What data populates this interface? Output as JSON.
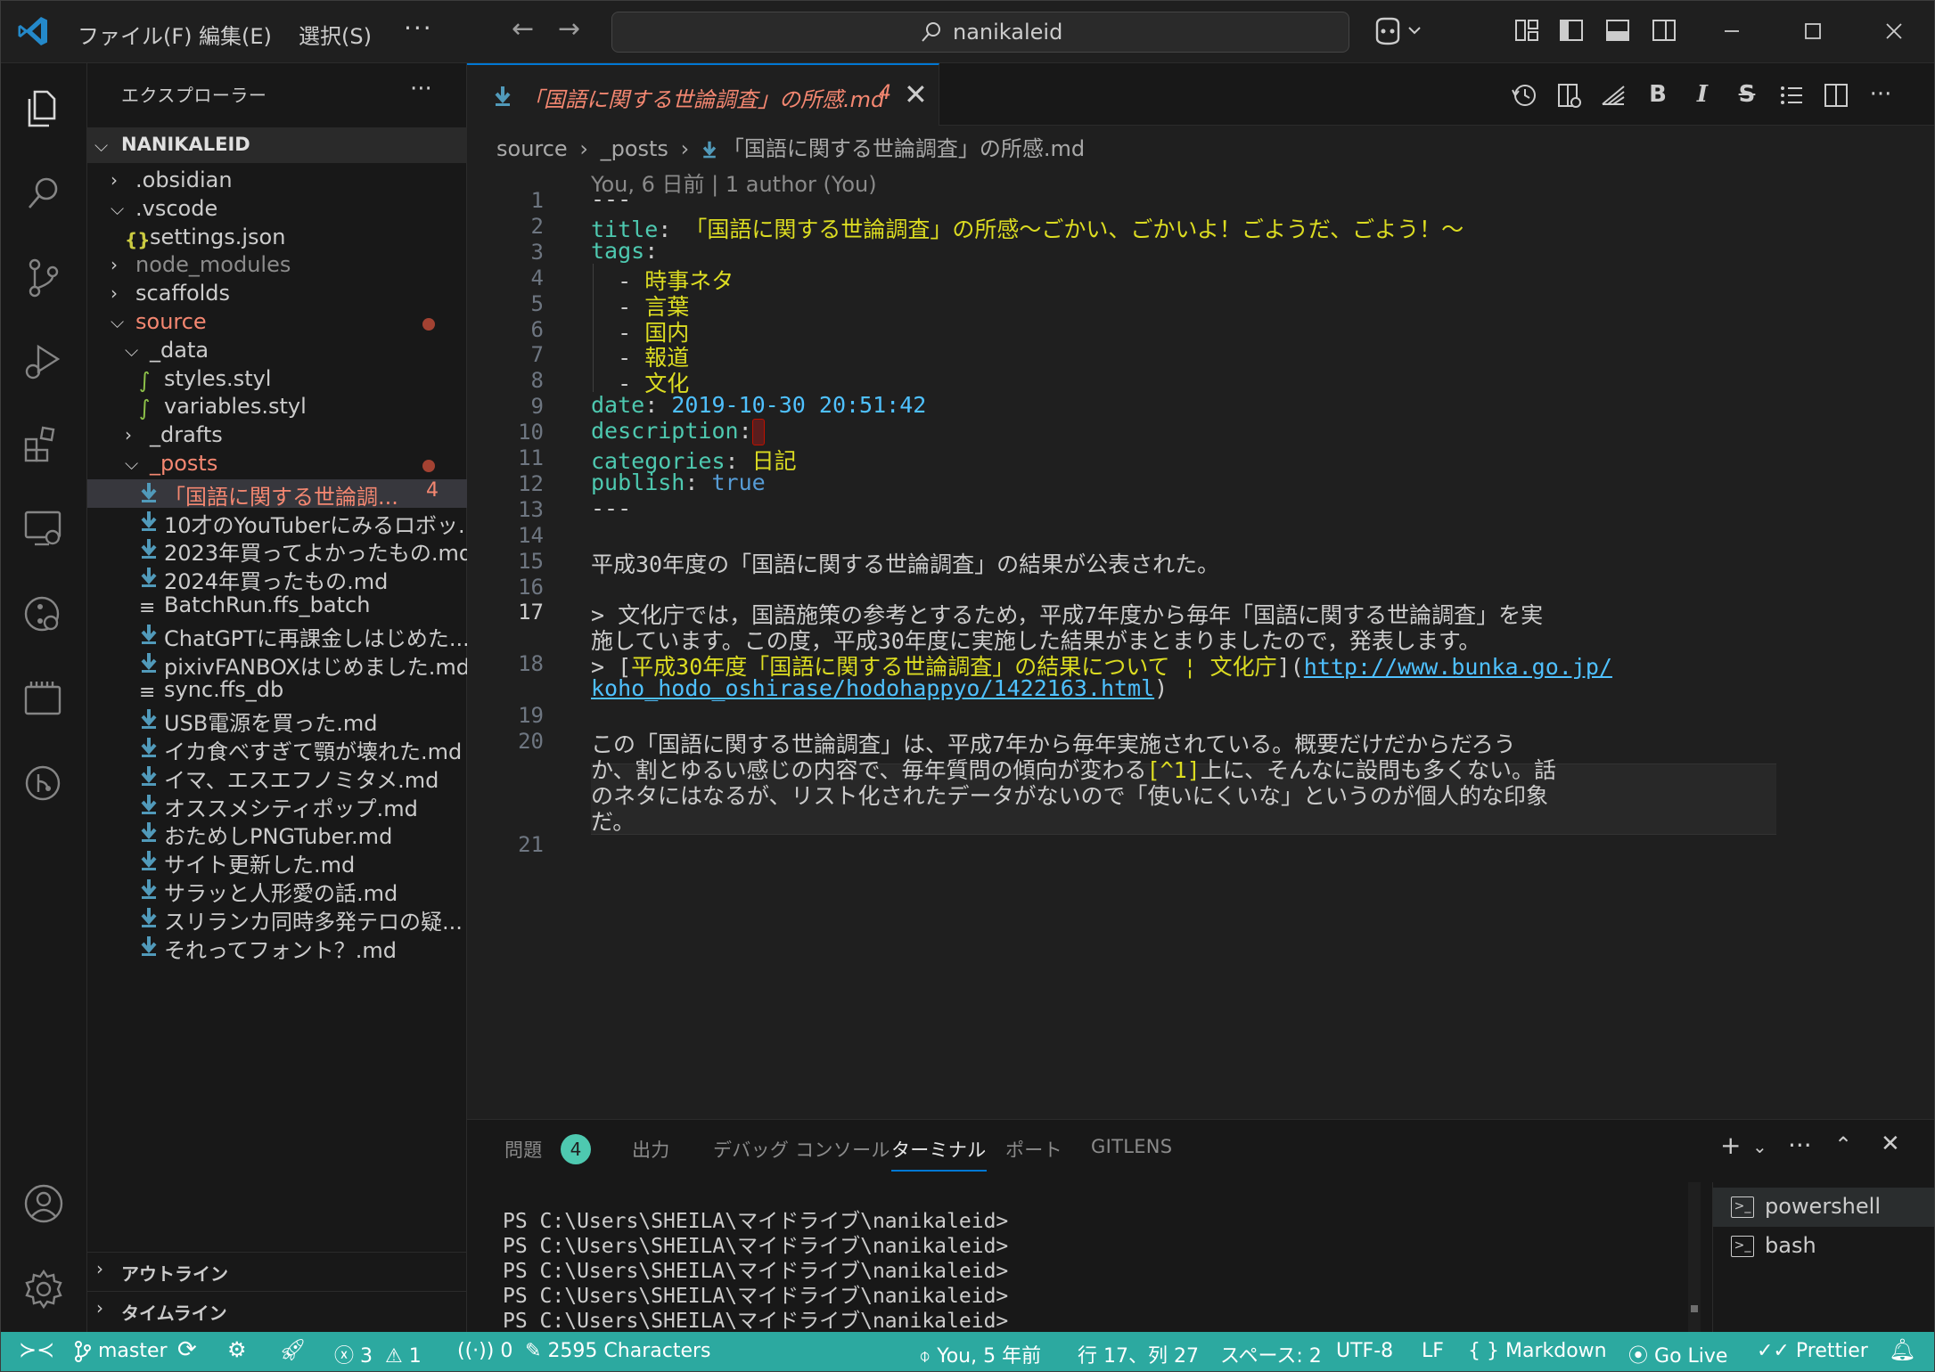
{
  "titlebar": {
    "menus": [
      "ファイル(F)",
      "編集(E)",
      "選択(S)"
    ],
    "more": "···",
    "search_text": "nanikaleid"
  },
  "sidebar": {
    "title": "エクスプローラー",
    "more": "···",
    "root": "NANIKALEID",
    "tree": [
      {
        "label": ".obsidian",
        "type": "folder",
        "open": false,
        "depth": 1
      },
      {
        "label": ".vscode",
        "type": "folder",
        "open": true,
        "depth": 1
      },
      {
        "label": "settings.json",
        "type": "json",
        "depth": 2
      },
      {
        "label": "node_modules",
        "type": "folder",
        "open": false,
        "depth": 1,
        "dim": true
      },
      {
        "label": "scaffolds",
        "type": "folder",
        "open": false,
        "depth": 1
      },
      {
        "label": "source",
        "type": "folder",
        "open": true,
        "depth": 1,
        "modified": true
      },
      {
        "label": "_data",
        "type": "folder",
        "open": true,
        "depth": 2
      },
      {
        "label": "styles.styl",
        "type": "styl",
        "depth": 3
      },
      {
        "label": "variables.styl",
        "type": "styl",
        "depth": 3
      },
      {
        "label": "_drafts",
        "type": "folder",
        "open": false,
        "depth": 2
      },
      {
        "label": "_posts",
        "type": "folder",
        "open": true,
        "depth": 2,
        "modified": true
      },
      {
        "label": "「国語に関する世論調...",
        "type": "md",
        "depth": 3,
        "modified": true,
        "selected": true,
        "badge": "4"
      },
      {
        "label": "10才のYouTuberにみるロボッ...",
        "type": "md",
        "depth": 3
      },
      {
        "label": "2023年買ってよかったもの.md",
        "type": "md",
        "depth": 3
      },
      {
        "label": "2024年買ったもの.md",
        "type": "md",
        "depth": 3
      },
      {
        "label": "BatchRun.ffs_batch",
        "type": "txt",
        "depth": 3
      },
      {
        "label": "ChatGPTに再課金しはじめた....",
        "type": "md",
        "depth": 3
      },
      {
        "label": "pixivFANBOXはじめました.md",
        "type": "md",
        "depth": 3
      },
      {
        "label": "sync.ffs_db",
        "type": "txt",
        "depth": 3
      },
      {
        "label": "USB電源を買った.md",
        "type": "md",
        "depth": 3
      },
      {
        "label": "イカ食べすぎて顎が壊れた.md",
        "type": "md",
        "depth": 3
      },
      {
        "label": "イマ、エスエフノミタメ.md",
        "type": "md",
        "depth": 3
      },
      {
        "label": "オススメシティポップ.md",
        "type": "md",
        "depth": 3
      },
      {
        "label": "おためしPNGTuber.md",
        "type": "md",
        "depth": 3
      },
      {
        "label": "サイト更新した.md",
        "type": "md",
        "depth": 3
      },
      {
        "label": "サラッと人形愛の話.md",
        "type": "md",
        "depth": 3
      },
      {
        "label": "スリランカ同時多発テロの疑...",
        "type": "md",
        "depth": 3
      },
      {
        "label": "それってフォント？.md",
        "type": "md",
        "depth": 3
      }
    ],
    "sections": [
      "アウトライン",
      "タイムライン"
    ]
  },
  "tab": {
    "label": "「国語に関する世論調査」の所感.md",
    "count": "4",
    "close": "✕"
  },
  "editor_tools": [
    "history",
    "open-changes",
    "toggle-inline",
    "B",
    "I",
    "S",
    "list",
    "split",
    "···"
  ],
  "breadcrumb": [
    "source",
    "_posts",
    "「国語に関する世論調査」の所感.md"
  ],
  "blame": "You, 6 日前 | 1 author (You)",
  "lines": {
    "l1": "---",
    "l2_key": "title",
    "l2_val": "「国語に関する世論調査」の所感～ごかい、ごかいよ！ごようだ、ごよう！～",
    "l3_key": "tags",
    "tags": [
      "時事ネタ",
      "言葉",
      "国内",
      "報道",
      "文化"
    ],
    "l9_key": "date",
    "l9_val": "2019-10-30 20:51:42",
    "l10_key": "description",
    "l11_key": "categories",
    "l11_val": "日記",
    "l12_key": "publish",
    "l12_val": "true",
    "l13": "---",
    "l15": "平成30年度の「国語に関する世論調査」の結果が公表された。",
    "l17a": "> 文化庁では，国語施策の参考とするため，平成7年度から毎年「国語に関する世論調査」を実",
    "l17b": "施しています。この度，平成30年度に実施した結果がまとまりましたので，発表します。",
    "l18_pre": "> [",
    "l18_link_text": "平成30年度「国語に関する世論調査」の結果について ¦ 文化庁",
    "l18_mid": "](",
    "l18_url1": "http://www.bunka.go.jp/",
    "l18_url2": "koho_hodo_oshirase/hodohappyo/1422163.html",
    "l18_end": ")",
    "l20a": "この「国語に関する世論調査」は、平成7年から毎年実施されている。概要だけだからだろう",
    "l20b": "か、割とゆるい感じの内容で、毎年質問の傾向が変わる[^1]上に、そんなに設問も多くない。話",
    "l20c": "のネタにはなるが、リスト化されたデータがないので「使いにくいな」というのが個人的な印象",
    "l20d": "だ。"
  },
  "line_numbers": [
    "1",
    "2",
    "3",
    "4",
    "5",
    "6",
    "7",
    "8",
    "9",
    "10",
    "11",
    "12",
    "13",
    "14",
    "15",
    "16",
    "17",
    "18",
    "19",
    "20",
    "21"
  ],
  "current_line": "17",
  "panel": {
    "tabs": [
      "問題",
      "出力",
      "デバッグ コンソール",
      "ターミナル",
      "ポート",
      "GITLENS"
    ],
    "problems_badge": "4",
    "active_tab": "ターミナル",
    "terminal_lines": [
      "PS C:\\Users\\SHEILA\\マイドライブ\\nanikaleid>",
      "PS C:\\Users\\SHEILA\\マイドライブ\\nanikaleid>",
      "PS C:\\Users\\SHEILA\\マイドライブ\\nanikaleid>",
      "PS C:\\Users\\SHEILA\\マイドライブ\\nanikaleid>",
      "PS C:\\Users\\SHEILA\\マイドライブ\\nanikaleid>"
    ],
    "terminals": [
      "powershell",
      "bash"
    ]
  },
  "status": {
    "branch": "master",
    "errors": "3",
    "warnings": "1",
    "ports": "0",
    "characters": "2595 Characters",
    "blame": "You, 5 年前",
    "position": "行 17、列 27",
    "spaces": "スペース: 2",
    "encoding": "UTF-8",
    "eol": "LF",
    "language": "Markdown",
    "golive": "Go Live",
    "prettier": "Prettier"
  },
  "colors": {
    "accent": "#0078d4",
    "statusbar": "#2ca9a0",
    "modified": "#f48771",
    "yaml_key": "#4ec9b0",
    "yaml_string": "#dcdc22"
  }
}
